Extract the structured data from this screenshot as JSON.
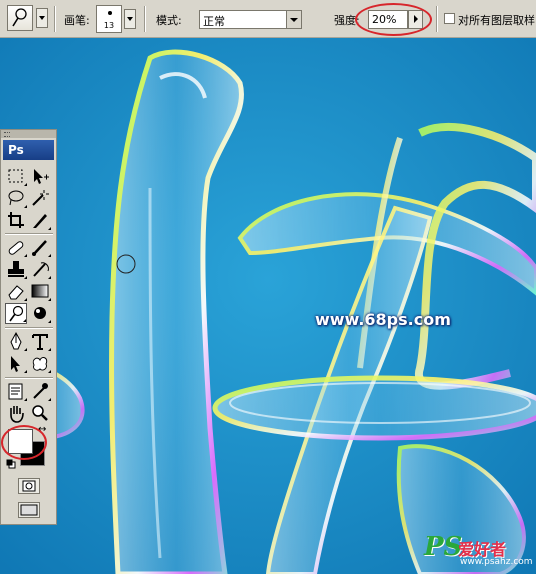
{
  "options_bar": {
    "tool_preset_icon": "dodge-tool-icon",
    "brush_label": "画笔:",
    "brush_size": "13",
    "mode_label": "模式:",
    "mode_value": "正常",
    "strength_label": "强度:",
    "strength_value": "20%",
    "sample_all_layers_label": "对所有图层取样",
    "sample_all_layers_checked": false
  },
  "toolbox": {
    "header": "Ps",
    "tools": [
      "rectangular-marquee-icon",
      "move-icon",
      "lasso-icon",
      "magic-wand-icon",
      "crop-icon",
      "slice-icon",
      "healing-brush-icon",
      "brush-icon",
      "clone-stamp-icon",
      "history-brush-icon",
      "eraser-icon",
      "gradient-icon",
      "dodge-icon",
      "sharpen-icon",
      "pen-icon",
      "type-icon",
      "path-selection-icon",
      "custom-shape-icon",
      "notes-icon",
      "eyedropper-icon",
      "hand-icon",
      "zoom-icon"
    ],
    "foreground_color": "#ffffff",
    "background_color": "#000000",
    "active_tool": "dodge-icon"
  },
  "canvas": {
    "background_color": "#1c8ec9",
    "url_text": "www.68ps.com"
  },
  "watermark": {
    "logo_text": "PS",
    "cn_text": "爱好者",
    "site_text": "www.psahz.com"
  },
  "highlight_color": "#d7262b"
}
